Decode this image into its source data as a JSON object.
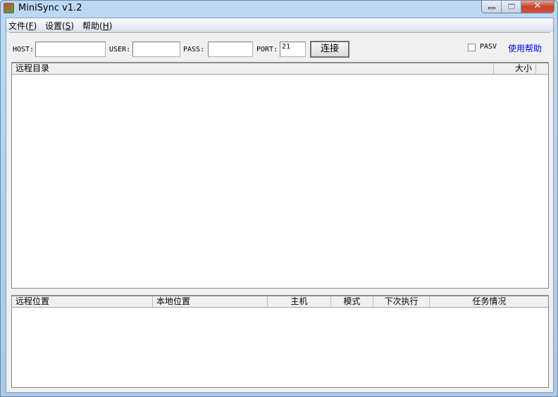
{
  "window": {
    "title": "MiniSync v1.2"
  },
  "menu": [
    {
      "label": "文件",
      "key": "F"
    },
    {
      "label": "设置",
      "key": "S"
    },
    {
      "label": "帮助",
      "key": "H"
    }
  ],
  "toolbar": {
    "host_label": "HOST:",
    "host_value": "",
    "user_label": "USER:",
    "user_value": "",
    "pass_label": "PASS:",
    "pass_value": "",
    "port_label": "PORT:",
    "port_value": "21",
    "connect_label": "连接",
    "pasv_label": "PASV",
    "pasv_checked": false,
    "help_link": "使用帮助"
  },
  "remote_list": {
    "columns": [
      "远程目录",
      "大小"
    ],
    "rows": []
  },
  "task_list": {
    "columns": [
      "远程位置",
      "本地位置",
      "主机",
      "模式",
      "下次执行",
      "任务情况"
    ],
    "rows": []
  }
}
